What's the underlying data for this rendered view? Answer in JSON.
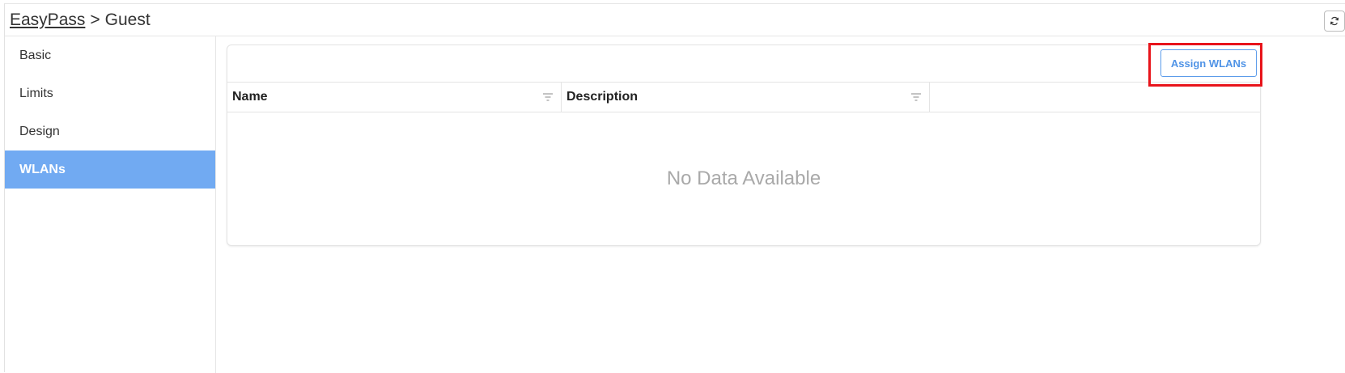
{
  "header": {
    "breadcrumb_root": "EasyPass",
    "breadcrumb_sep": ">",
    "breadcrumb_current": "Guest"
  },
  "sidebar": {
    "items": [
      {
        "label": "Basic"
      },
      {
        "label": "Limits"
      },
      {
        "label": "Design"
      },
      {
        "label": "WLANs",
        "active": true
      }
    ]
  },
  "toolbar": {
    "assign_label": "Assign WLANs"
  },
  "table": {
    "columns": [
      "Name",
      "Description",
      ""
    ],
    "empty_text": "No Data Available"
  },
  "colors": {
    "accent": "#71aaf2",
    "button_text": "#4f93e6",
    "highlight": "#e8141b"
  },
  "icons": {
    "refresh": "refresh-icon",
    "filter": "filter-icon"
  }
}
